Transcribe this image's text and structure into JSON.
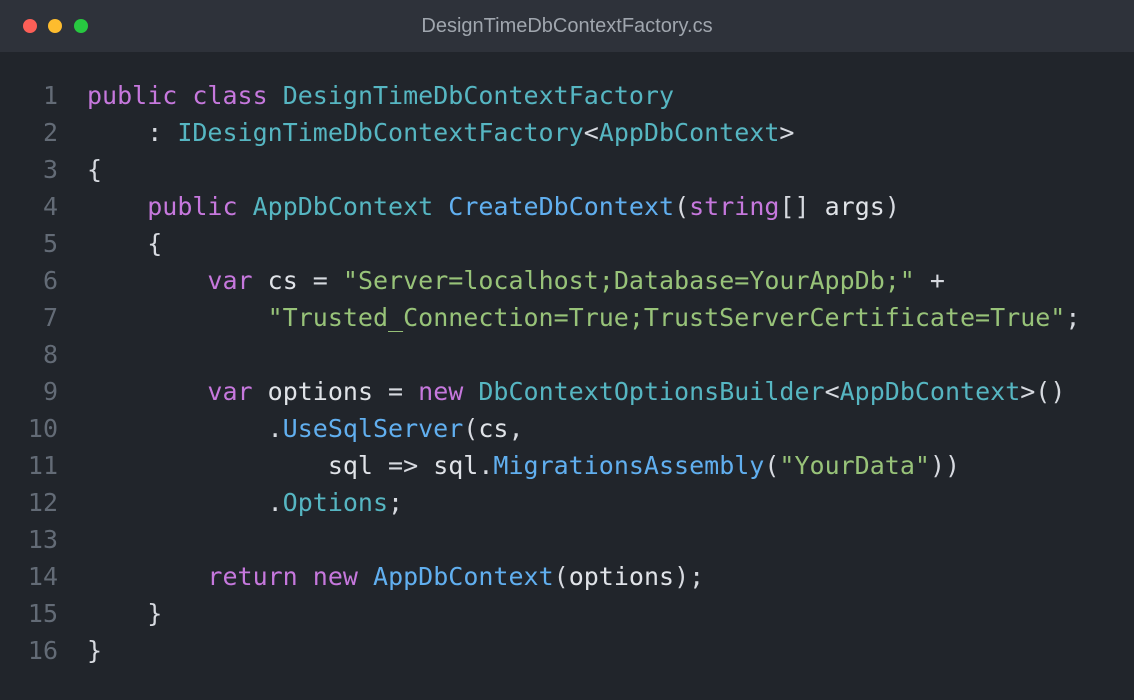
{
  "window": {
    "title": "DesignTimeDbContextFactory.cs",
    "traffic_lights": {
      "close": "#fc5f57",
      "minimize": "#fdbc2e",
      "maximize": "#27c840"
    }
  },
  "editor": {
    "colors": {
      "background": "#21252b",
      "titlebar": "#2e323a",
      "keyword": "#c678dd",
      "type": "#56b6c2",
      "function": "#61afef",
      "string": "#98c379",
      "line_number": "#636b76"
    },
    "lines": [
      {
        "number": "1",
        "tokens": [
          {
            "t": "kw",
            "v": "public"
          },
          {
            "t": "punct",
            "v": " "
          },
          {
            "t": "kw",
            "v": "class"
          },
          {
            "t": "punct",
            "v": " "
          },
          {
            "t": "type",
            "v": "DesignTimeDbContextFactory"
          }
        ]
      },
      {
        "number": "2",
        "tokens": [
          {
            "t": "punct",
            "v": "    : "
          },
          {
            "t": "type",
            "v": "IDesignTimeDbContextFactory"
          },
          {
            "t": "punct",
            "v": "<"
          },
          {
            "t": "type",
            "v": "AppDbContext"
          },
          {
            "t": "punct",
            "v": ">"
          }
        ]
      },
      {
        "number": "3",
        "tokens": [
          {
            "t": "punct",
            "v": "{"
          }
        ]
      },
      {
        "number": "4",
        "tokens": [
          {
            "t": "punct",
            "v": "    "
          },
          {
            "t": "kw",
            "v": "public"
          },
          {
            "t": "punct",
            "v": " "
          },
          {
            "t": "type",
            "v": "AppDbContext"
          },
          {
            "t": "punct",
            "v": " "
          },
          {
            "t": "fn",
            "v": "CreateDbContext"
          },
          {
            "t": "punct",
            "v": "("
          },
          {
            "t": "kw",
            "v": "string"
          },
          {
            "t": "punct",
            "v": "[] "
          },
          {
            "t": "id",
            "v": "args"
          },
          {
            "t": "punct",
            "v": ")"
          }
        ]
      },
      {
        "number": "5",
        "tokens": [
          {
            "t": "punct",
            "v": "    {"
          }
        ]
      },
      {
        "number": "6",
        "tokens": [
          {
            "t": "punct",
            "v": "        "
          },
          {
            "t": "kw",
            "v": "var"
          },
          {
            "t": "punct",
            "v": " "
          },
          {
            "t": "id",
            "v": "cs"
          },
          {
            "t": "punct",
            "v": " = "
          },
          {
            "t": "str",
            "v": "\"Server=localhost;Database=YourAppDb;\""
          },
          {
            "t": "punct",
            "v": " +"
          }
        ]
      },
      {
        "number": "7",
        "tokens": [
          {
            "t": "punct",
            "v": "            "
          },
          {
            "t": "str",
            "v": "\"Trusted_Connection=True;TrustServerCertificate=True\""
          },
          {
            "t": "punct",
            "v": ";"
          }
        ]
      },
      {
        "number": "8",
        "tokens": []
      },
      {
        "number": "9",
        "tokens": [
          {
            "t": "punct",
            "v": "        "
          },
          {
            "t": "kw",
            "v": "var"
          },
          {
            "t": "punct",
            "v": " "
          },
          {
            "t": "id",
            "v": "options"
          },
          {
            "t": "punct",
            "v": " = "
          },
          {
            "t": "kw",
            "v": "new"
          },
          {
            "t": "punct",
            "v": " "
          },
          {
            "t": "type",
            "v": "DbContextOptionsBuilder"
          },
          {
            "t": "punct",
            "v": "<"
          },
          {
            "t": "type",
            "v": "AppDbContext"
          },
          {
            "t": "punct",
            "v": ">()"
          }
        ]
      },
      {
        "number": "10",
        "tokens": [
          {
            "t": "punct",
            "v": "            ."
          },
          {
            "t": "fn",
            "v": "UseSqlServer"
          },
          {
            "t": "punct",
            "v": "("
          },
          {
            "t": "id",
            "v": "cs"
          },
          {
            "t": "punct",
            "v": ","
          }
        ]
      },
      {
        "number": "11",
        "tokens": [
          {
            "t": "punct",
            "v": "                "
          },
          {
            "t": "id",
            "v": "sql"
          },
          {
            "t": "punct",
            "v": " => "
          },
          {
            "t": "id",
            "v": "sql"
          },
          {
            "t": "punct",
            "v": "."
          },
          {
            "t": "fn",
            "v": "MigrationsAssembly"
          },
          {
            "t": "punct",
            "v": "("
          },
          {
            "t": "str",
            "v": "\"YourData\""
          },
          {
            "t": "punct",
            "v": "))"
          }
        ]
      },
      {
        "number": "12",
        "tokens": [
          {
            "t": "punct",
            "v": "            ."
          },
          {
            "t": "type",
            "v": "Options"
          },
          {
            "t": "punct",
            "v": ";"
          }
        ]
      },
      {
        "number": "13",
        "tokens": []
      },
      {
        "number": "14",
        "tokens": [
          {
            "t": "punct",
            "v": "        "
          },
          {
            "t": "kw",
            "v": "return"
          },
          {
            "t": "punct",
            "v": " "
          },
          {
            "t": "kw",
            "v": "new"
          },
          {
            "t": "punct",
            "v": " "
          },
          {
            "t": "fn",
            "v": "AppDbContext"
          },
          {
            "t": "punct",
            "v": "("
          },
          {
            "t": "id",
            "v": "options"
          },
          {
            "t": "punct",
            "v": ");"
          }
        ]
      },
      {
        "number": "15",
        "tokens": [
          {
            "t": "punct",
            "v": "    }"
          }
        ]
      },
      {
        "number": "16",
        "tokens": [
          {
            "t": "punct",
            "v": "}"
          }
        ]
      }
    ]
  }
}
